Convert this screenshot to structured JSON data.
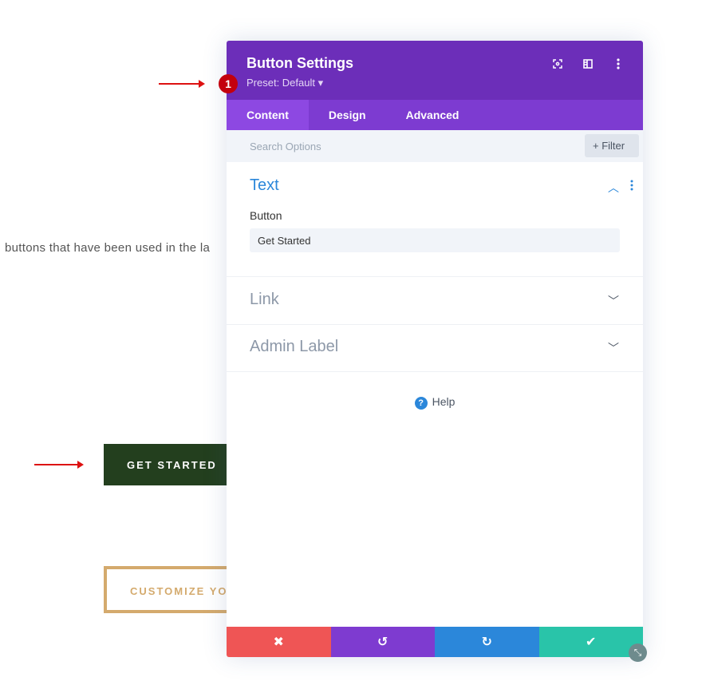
{
  "background": {
    "paragraph": "buttons that have been used in the la",
    "primary_button": "GET STARTED",
    "secondary_button": "CUSTOMIZE YOU"
  },
  "panel": {
    "title": "Button Settings",
    "preset": "Preset: Default ▾",
    "badge": "1",
    "icons": [
      "focus-icon",
      "split-view-icon",
      "more-icon"
    ],
    "tabs": [
      {
        "label": "Content",
        "active": true
      },
      {
        "label": "Design"
      },
      {
        "label": "Advanced"
      }
    ],
    "search_placeholder": "Search Options",
    "filter_label": "+ Filter",
    "sections": [
      {
        "title": "Text",
        "open": true,
        "field_label": "Button",
        "field_value": "Get Started"
      },
      {
        "title": "Link",
        "open": false
      },
      {
        "title": "Admin Label",
        "open": false
      }
    ],
    "help": "Help",
    "footer": {
      "cancel": "✖",
      "undo": "↺",
      "redo": "↻",
      "save": "✔"
    }
  },
  "colors": {
    "header": "#6c2eb9",
    "tabs": "#7d3bd1",
    "accent_text": "#2b87da",
    "cancel": "#ef5555",
    "undo": "#7e3bd0",
    "redo": "#2b87da",
    "save": "#29c4a9"
  }
}
